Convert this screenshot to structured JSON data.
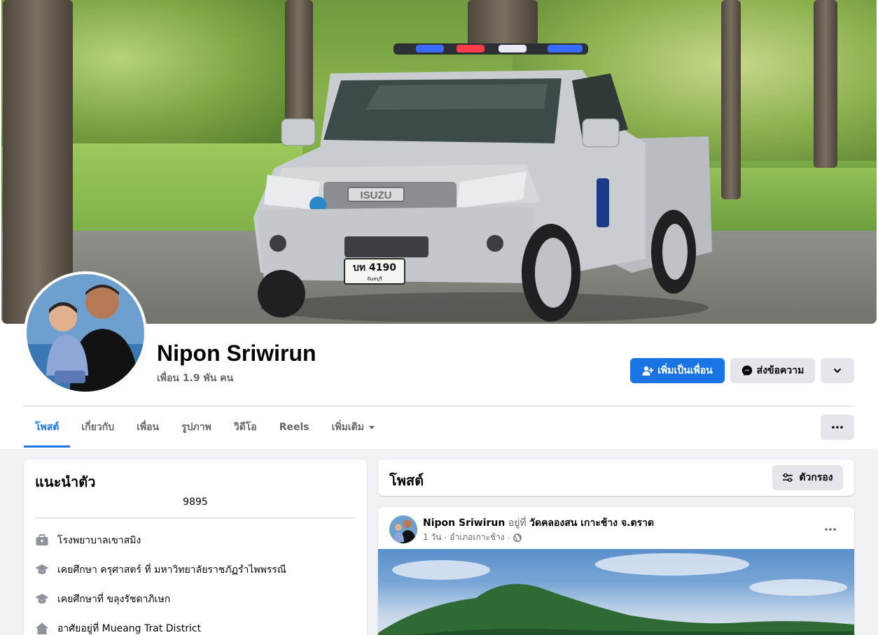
{
  "profile": {
    "name": "Nipon Sriwirun",
    "friends_count": "เพื่อน 1.9 พัน คน"
  },
  "actions": {
    "add_friend": "เพิ่มเป็นเพื่อน",
    "message": "ส่งข้อความ"
  },
  "tabs": [
    {
      "label": "โพสต์",
      "active": true
    },
    {
      "label": "เกี่ยวกับ",
      "active": false
    },
    {
      "label": "เพื่อน",
      "active": false
    },
    {
      "label": "รูปภาพ",
      "active": false
    },
    {
      "label": "วิดีโอ",
      "active": false
    },
    {
      "label": "Reels",
      "active": false
    },
    {
      "label": "เพิ่มเติม",
      "active": false
    }
  ],
  "cover": {
    "plate": "บท 4190",
    "plate_province": "จันทบุรี",
    "brand": "ISUZU"
  },
  "intro": {
    "title": "แนะนำตัว",
    "bio": "9895",
    "items": [
      {
        "icon": "briefcase-icon",
        "text": "โรงพยาบาลเขาสมิง"
      },
      {
        "icon": "graduation-cap-icon",
        "text": "เคยศึกษา ครุศาสตร์ ที่ มหาวิทยาลัยราชภัฏรำไพพรรณี"
      },
      {
        "icon": "graduation-cap-icon",
        "text": "เคยศึกษาที่ ขลุงรัชดาภิเษก"
      },
      {
        "icon": "home-icon",
        "text": "อาศัยอยู่ที่ Mueang Trat District"
      }
    ]
  },
  "posts": {
    "title": "โพสต์",
    "filter_label": "ตัวกรอง",
    "items": [
      {
        "author": "Nipon Sriwirun",
        "at_word": "อยู่ที่",
        "place": "วัดคลองสน เกาะช้าง จ.ตราด",
        "time": "1 วัน",
        "location": "อำเภอเกาะช้าง",
        "privacy": "globe-icon"
      }
    ]
  },
  "colors": {
    "accent": "#1b74e4",
    "secondary_button": "#e4e6eb",
    "page_background": "#f0f2f5",
    "muted_text": "#65676b"
  }
}
